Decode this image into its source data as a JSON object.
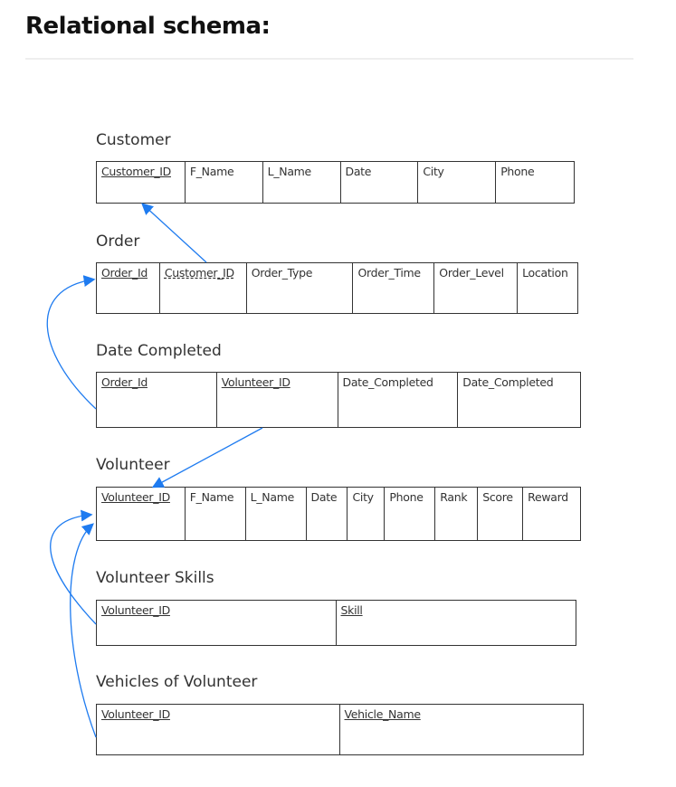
{
  "heading": "Relational schema:",
  "tables": [
    {
      "title": "Customer",
      "columns": [
        {
          "name": "Customer_ID",
          "key": "pk"
        },
        {
          "name": "F_Name"
        },
        {
          "name": "L_Name"
        },
        {
          "name": "Date"
        },
        {
          "name": "City"
        },
        {
          "name": "Phone"
        }
      ]
    },
    {
      "title": "Order",
      "columns": [
        {
          "name": "Order_Id",
          "key": "pk"
        },
        {
          "name": "Customer_ID",
          "key": "fk"
        },
        {
          "name": "Order_Type"
        },
        {
          "name": "Order_Time"
        },
        {
          "name": "Order_Level"
        },
        {
          "name": "Location"
        }
      ]
    },
    {
      "title": "Date Completed",
      "columns": [
        {
          "name": "Order_Id",
          "key": "pk"
        },
        {
          "name": "Volunteer_ID",
          "key": "pk"
        },
        {
          "name": "Date_Completed"
        },
        {
          "name": "Date_Completed"
        }
      ]
    },
    {
      "title": "Volunteer",
      "columns": [
        {
          "name": "Volunteer_ID",
          "key": "pk"
        },
        {
          "name": "F_Name"
        },
        {
          "name": "L_Name"
        },
        {
          "name": "Date"
        },
        {
          "name": "City"
        },
        {
          "name": "Phone"
        },
        {
          "name": "Rank"
        },
        {
          "name": "Score"
        },
        {
          "name": "Reward"
        }
      ]
    },
    {
      "title": "Volunteer Skills",
      "columns": [
        {
          "name": "Volunteer_ID",
          "key": "pk"
        },
        {
          "name": "Skill",
          "key": "pk"
        }
      ]
    },
    {
      "title": "Vehicles of Volunteer",
      "columns": [
        {
          "name": "Volunteer_ID",
          "key": "pk"
        },
        {
          "name": "Vehicle_Name",
          "key": "pk"
        }
      ]
    }
  ],
  "arrow_color": "#1e7bf0"
}
